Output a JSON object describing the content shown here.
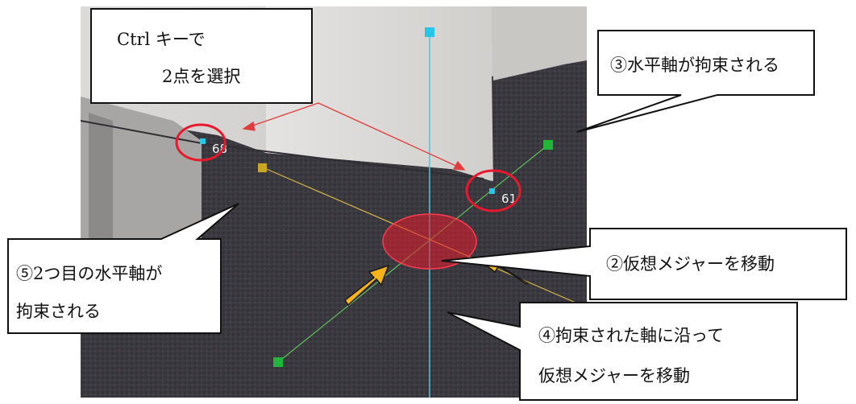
{
  "colors": {
    "floor": "#3c3a41",
    "wall": "#d3d1cf",
    "axis_vertical": "#4fc3dd",
    "axis_green": "#5fbf5a",
    "axis_yellow": "#d6b547",
    "handle_cyan": "#26c6e8",
    "handle_green": "#23b53a",
    "handle_yellow": "#c9a623",
    "marker": "#e8192c",
    "arrow": "#f5b21a"
  },
  "icons": [
    "square-handle-icon",
    "arrow-icon"
  ],
  "callouts": {
    "select": {
      "line1": "Ctrl キーで",
      "line2": "2点を選択"
    },
    "horizontal_axis": {
      "text": "③水平軸が拘束される"
    },
    "move_measure": {
      "text": "②仮想メジャーを移動"
    },
    "second_axis": {
      "line1": "⑤2つ目の水平軸が",
      "line2": "拘束される"
    },
    "along_axis": {
      "line1": "④拘束された軸に沿って",
      "line2": "仮想メジャーを移動"
    }
  },
  "points": {
    "left_label": "68",
    "right_label": "61"
  }
}
